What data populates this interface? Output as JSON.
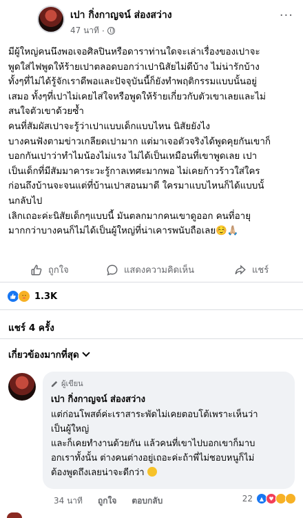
{
  "post": {
    "author": "เปา กิ่งกาญจน์ ส่องสว่าง",
    "time": "47 นาที",
    "separator": "·",
    "more_label": "···",
    "lines": [
      "มีผู้ใหญ่คนนึงพอเจอศิลปินหรือดาราท่านใดจะเล่าเรื่องของเปาจะ",
      "พูดใส่ไฟพูดให้ร้ายเปาตลอดบอกว่าเปานิสัยไม่ดีบ้าง ไม่น่ารักบ้าง",
      "ทั้งๆที่ไม่ได้รู้จักเราดีพอและปัจจุบันนี้ก็ยังทำพฤติกรรมแบบนั้นอยู่",
      "เสมอ ทั้งๆที่เปาไม่เคยไส่ใจหรือพูดให้ร้ายเกี่ยวกับตัวเขาเลยและไม่",
      "สนใจตัวเขาด้วยซ้ำ",
      "คนที่สัมผัสเปาจะรู้ว่าเปาแบบเด็กแบบไหน นิสัยยังไง",
      "บางคนฟังตามข่าวเกลียดเปามาก แต่มาเจอตัวจริงได้พูดคุยกันเขาก็",
      "บอกกันเปาว่าทำไมน้องไม่แรง ไม่ได้เป็นเหมือนที่เขาพูดเลย  เปา",
      "เป็นเด็กที่มีสัมมาคาระวะรู้กาลเทศะมากพอ ไม่เคยก้าวร้าวใส่ใคร",
      "ก่อนถึงบ้านจะจนแต่ที่บ้านเปาสอนมาดี ใครมาแบบไหนก็ได้แบบนั้",
      "นกลับไป",
      "เลิกเถอะค่ะนิสัยเด็กๆแบบนี้ มันตลกมากคนเขาดูออก คนที่อายุ",
      "มากกว่าบางคนก็ไม่ได้เป็นผู้ใหญ่ที่น่าเคารพนับถือเลย☺️🙏🏼"
    ]
  },
  "actions": {
    "like": "ถูกใจ",
    "comment": "แสดงความคิดเห็น",
    "share": "แชร์"
  },
  "reactions": {
    "count": "1.3K"
  },
  "shares_text": "แชร์ 4 ครั้ง",
  "comment_filter": "เกี่ยวข้องมากที่สุด",
  "comment": {
    "badge": "ผู้เขียน",
    "author": "เปา กิ่งกาญจน์ ส่องสว่าง",
    "lines": [
      "แต่ก่อนโพสต์ค่ะเราสาระพัดไม่เคยตอบโต้เพราะเห็นว่า",
      "เป็นผู้ใหญ่",
      "และก็เคยทำงานด้วยกัน แล้วคนที่เขาไปบอกเขาก็มาบ",
      "อกเราทั้งนั้น ต่างคนต่างอยู่เถอะค่ะถ้าพี่ไม่ชอบหนูก็ไม่",
      "ต้องพูดถึงเลยน่าจะดีกว่า"
    ],
    "time": "34 นาที",
    "like": "ถูกใจ",
    "reply": "ตอบกลับ",
    "reaction_count": "22"
  }
}
